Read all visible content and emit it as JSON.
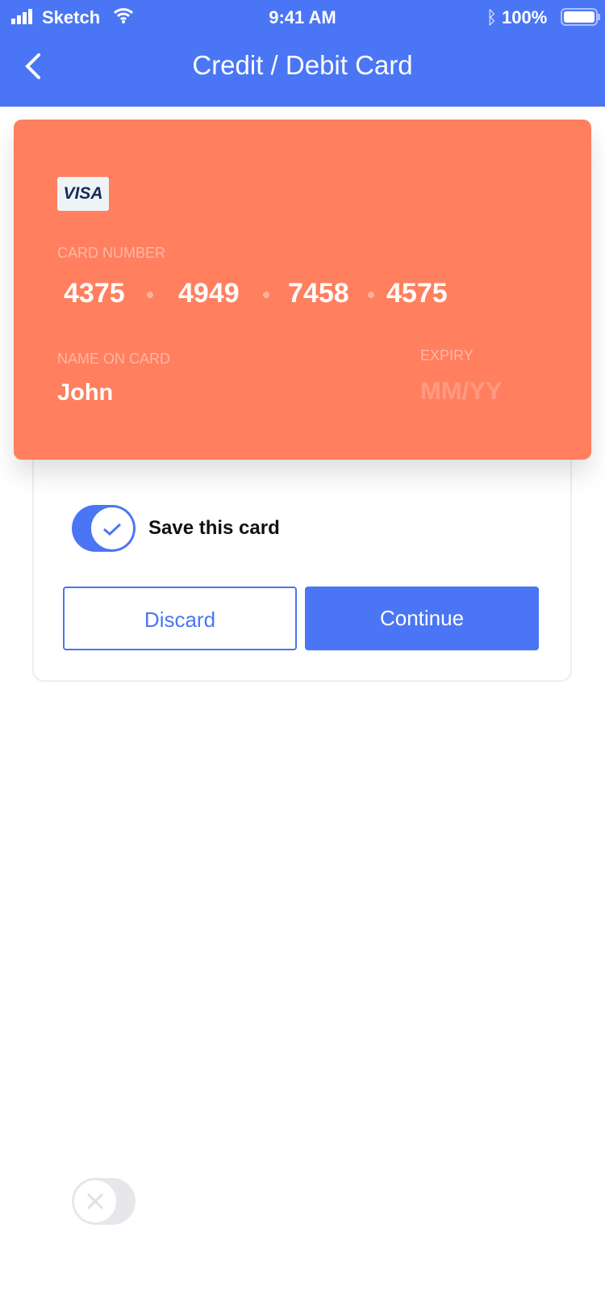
{
  "status_bar": {
    "carrier": "Sketch",
    "time": "9:41 AM",
    "battery": "100%"
  },
  "header": {
    "title": "Credit / Debit Card"
  },
  "card": {
    "brand": "VISA",
    "number_label": "CARD NUMBER",
    "number_groups": [
      "4375",
      "4949",
      "7458",
      "4575"
    ],
    "name_label": "NAME ON CARD",
    "name": "John",
    "expiry_label": "EXPIRY",
    "expiry_placeholder": "MM/YY",
    "color": "#ff7f5f"
  },
  "save_toggle": {
    "label": "Save this card",
    "on": true
  },
  "buttons": {
    "discard": "Discard",
    "continue": "Continue"
  },
  "bottom_toggle": {
    "on": false
  },
  "accent": "#4a76f5"
}
